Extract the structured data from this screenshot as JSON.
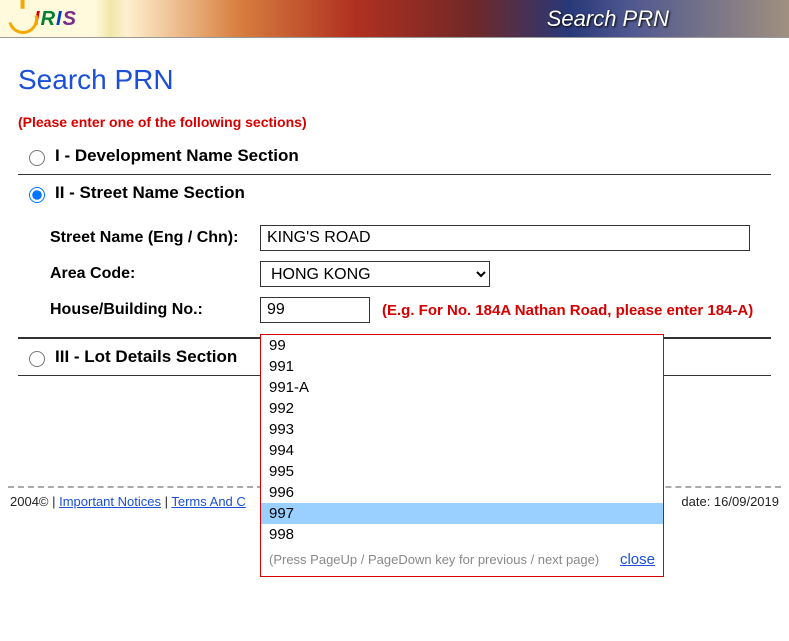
{
  "banner": {
    "title": "Search PRN"
  },
  "page": {
    "title": "Search PRN",
    "instruction": "(Please enter one of the following sections)"
  },
  "sections": {
    "s1": {
      "label": "I - Development Name Section",
      "checked": false
    },
    "s2": {
      "label": "II - Street Name Section",
      "checked": true
    },
    "s3": {
      "label": "III - Lot Details Section",
      "checked": false
    }
  },
  "form": {
    "street_label": "Street Name (Eng / Chn):",
    "street_value": "KING'S ROAD",
    "area_label": "Area Code:",
    "area_value": "HONG KONG",
    "house_label": "House/Building No.:",
    "house_value": "99",
    "house_hint": "(E.g. For No. 184A Nathan Road, please enter 184-A)"
  },
  "autocomplete": {
    "items": [
      "99",
      "991",
      "991-A",
      "992",
      "993",
      "994",
      "995",
      "996",
      "997",
      "998"
    ],
    "highlight_index": 8,
    "note": "(Press PageUp / PageDown key for previous / next page)",
    "close": "close"
  },
  "footer": {
    "copyright": "2004© | ",
    "link1": "Important Notices",
    "sep": " | ",
    "link2": "Terms And C",
    "right_prefix": "date: ",
    "date": "16/09/2019"
  }
}
